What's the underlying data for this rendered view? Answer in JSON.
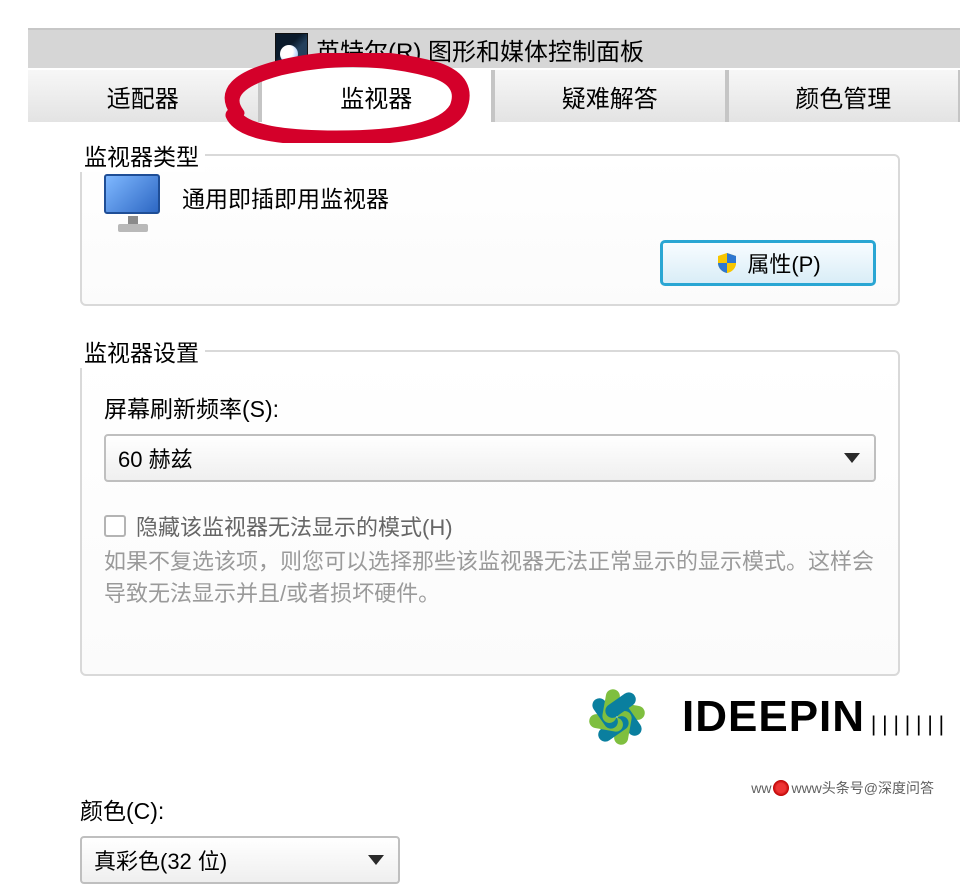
{
  "header": {
    "icon": "intel-graphics-icon",
    "title": "英特尔(R) 图形和媒体控制面板"
  },
  "tabs": [
    {
      "id": "adapter",
      "label": "适配器",
      "active": false
    },
    {
      "id": "monitor",
      "label": "监视器",
      "active": true
    },
    {
      "id": "trouble",
      "label": "疑难解答",
      "active": false
    },
    {
      "id": "color",
      "label": "颜色管理",
      "active": false
    }
  ],
  "monitor_type": {
    "legend": "监视器类型",
    "name": "通用即插即用监视器",
    "properties_button": "属性(P)"
  },
  "monitor_settings": {
    "legend": "监视器设置",
    "refresh_label": "屏幕刷新频率(S):",
    "refresh_value": "60 赫兹",
    "hide_modes_checkbox_label": "隐藏该监视器无法显示的模式(H)",
    "hide_modes_checked": false,
    "hide_modes_hint": "如果不复选该项，则您可以选择那些该监视器无法正常显示的显示模式。这样会导致无法显示并且/或者损坏硬件。"
  },
  "color_section": {
    "label": "颜色(C):",
    "value": "真彩色(32 位)"
  },
  "annotation": {
    "circled_tab": "monitor"
  },
  "watermark": {
    "brand": "IDEEPIN",
    "subline": "www头条号@深度问答"
  },
  "colors": {
    "button_border": "#2aa6d3",
    "red_annotation": "#d4002a"
  }
}
